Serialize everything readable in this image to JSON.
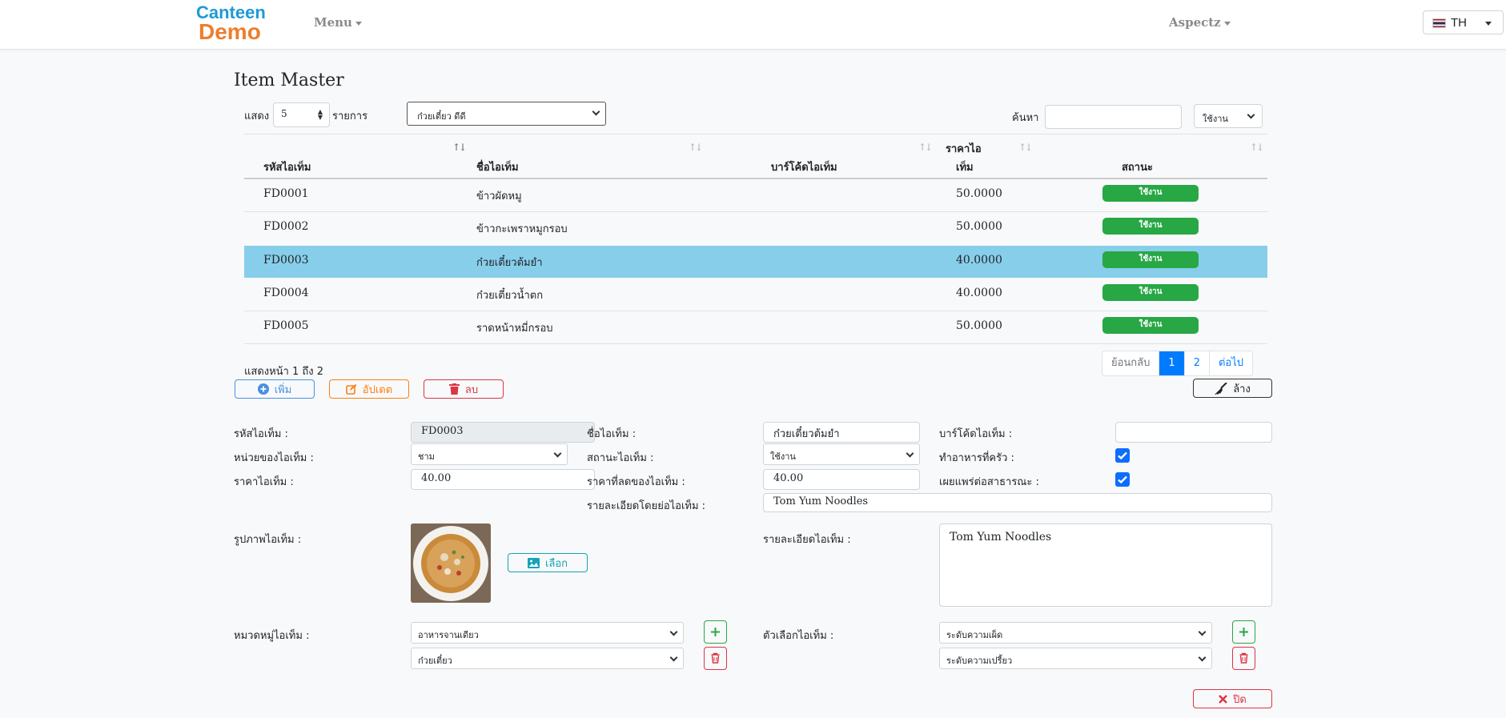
{
  "brand": {
    "line1": "Canteen",
    "line2": "Demo"
  },
  "nav": {
    "menu": "Menu",
    "user": "Aspectz",
    "lang": "TH"
  },
  "page_title": "Item Master",
  "list_controls": {
    "show_label": "แสดง",
    "page_size": "5",
    "items_label": "รายการ",
    "shop": "ก๋วยเตี๋ยว ดีดี",
    "search_label": "ค้นหา",
    "search_value": "",
    "status_filter": "ใช้งาน"
  },
  "table": {
    "headers": [
      "รหัสไอเท็ม",
      "ชื่อไอเท็ม",
      "บาร์โค้ดไอเท็ม",
      "ราคาไอ",
      "เท็ม",
      "สถานะ"
    ],
    "rows": [
      {
        "code": "FD0001",
        "name": "ข้าวผัดหมู",
        "barcode": "",
        "price": "50.0000",
        "status": "ใช้งาน"
      },
      {
        "code": "FD0002",
        "name": "ข้าวกะเพราหมูกรอบ",
        "barcode": "",
        "price": "50.0000",
        "status": "ใช้งาน"
      },
      {
        "code": "FD0003",
        "name": "ก๋วยเตี๋ยวต้มยำ",
        "barcode": "",
        "price": "40.0000",
        "status": "ใช้งาน"
      },
      {
        "code": "FD0004",
        "name": "ก๋วยเตี๋ยวน้ำตก",
        "barcode": "",
        "price": "40.0000",
        "status": "ใช้งาน"
      },
      {
        "code": "FD0005",
        "name": "ราดหน้าหมี่กรอบ",
        "barcode": "",
        "price": "50.0000",
        "status": "ใช้งาน"
      }
    ],
    "selected_row": 3
  },
  "pagination": {
    "info": "แสดงหน้า 1 ถึง 2",
    "prev": "ย้อนกลับ",
    "pages": [
      "1",
      "2"
    ],
    "next": "ต่อไป",
    "current": "1"
  },
  "actions": {
    "add": "เพิ่ม",
    "update": "อัปเดต",
    "delete": "ลบ",
    "clear": "ล้าง",
    "choose": "เลือก",
    "close": "ปิด"
  },
  "form": {
    "code_label": "รหัสไอเท็ม :",
    "code": "FD0003",
    "name_label": "ชื่อไอเท็ม :",
    "name": "ก๋วยเตี๋ยวต้มยำ",
    "barcode_label": "บาร์โค้ดไอเท็ม :",
    "barcode": "",
    "unit_label": "หน่วยของไอเท็ม :",
    "unit": "ชาม",
    "status_label": "สถานะไอเท็ม :",
    "status": "ใช้งาน",
    "kitchen_label": "ทำอาหารที่ครัว :",
    "kitchen": true,
    "price_label": "ราคาไอเท็ม :",
    "price": "40.00",
    "discount_label": "ราคาที่ลดของไอเท็ม :",
    "discount_price": "40.00",
    "publish_label": "เผยแพร่ต่อสาธารณะ :",
    "publish": true,
    "short_desc_label": "รายละเอียดโดยย่อไอเท็ม :",
    "short_desc": "Tom Yum Noodles",
    "image_label": "รูปภาพไอเท็ม :",
    "desc_label": "รายละเอียดไอเท็ม :",
    "desc": "Tom Yum Noodles",
    "category_label": "หมวดหมู่ไอเท็ม :",
    "categories": [
      "อาหารจานเดียว",
      "ก๋วยเตี๋ยว"
    ],
    "option_label": "ตัวเลือกไอเท็ม :",
    "options": [
      "ระดับความเผ็ด",
      "ระดับความเปรี้ยว"
    ]
  },
  "colors": {
    "brand_blue": "#1e9ad6",
    "brand_orange": "#ef7d2c",
    "active_green": "#28a745",
    "selected_row": "#87ceeb",
    "primary": "#007bff"
  }
}
